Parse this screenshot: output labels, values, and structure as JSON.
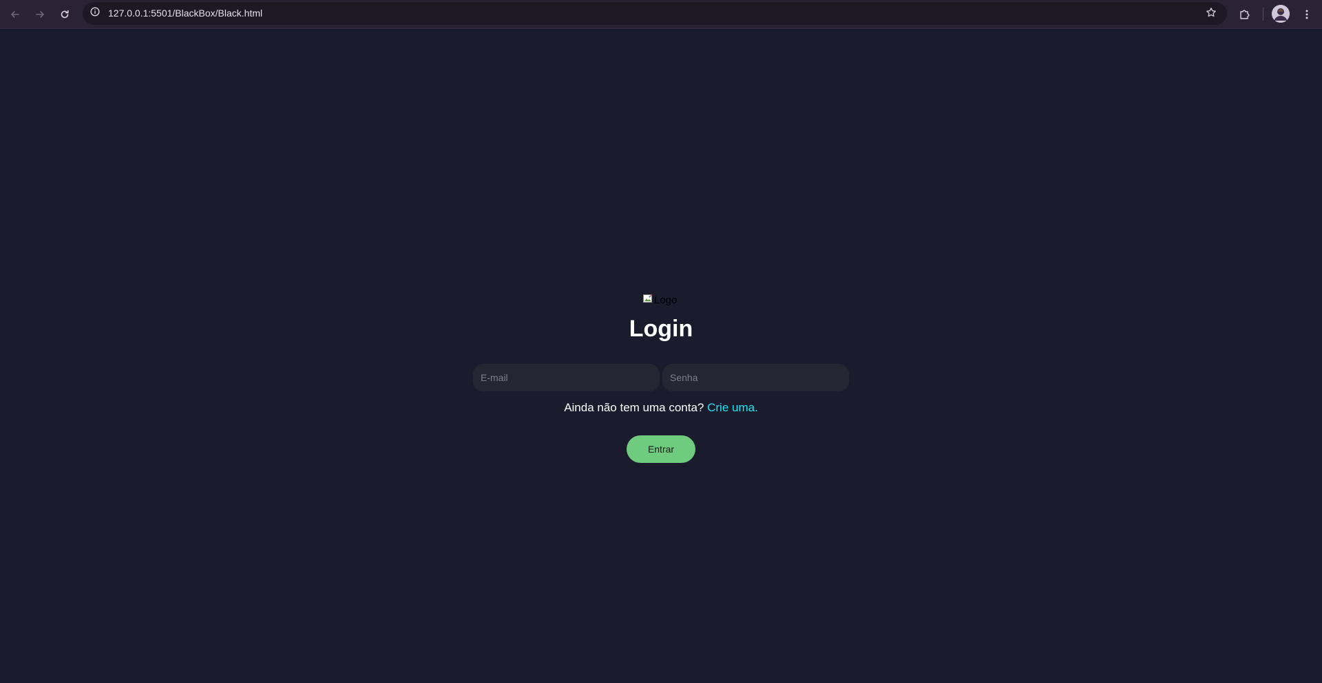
{
  "browser": {
    "url": "127.0.0.1:5501/BlackBox/Black.html",
    "icons": {
      "back": "arrow-left-icon",
      "forward": "arrow-right-icon",
      "reload": "reload-icon",
      "site_info": "info-icon",
      "bookmark": "star-icon",
      "extensions": "puzzle-icon",
      "profile": "avatar-icon",
      "menu": "kebab-menu-icon"
    }
  },
  "page": {
    "logo_alt": "Logo",
    "title": "Login",
    "email_placeholder": "E-mail",
    "password_placeholder": "Senha",
    "signup_prompt": "Ainda não tem uma conta?",
    "signup_link": "Crie uma.",
    "submit_label": "Entrar"
  },
  "colors": {
    "background": "#1b1b2e",
    "input_background": "#262633",
    "link": "#22e3ee",
    "button": "#6fcb7e"
  }
}
